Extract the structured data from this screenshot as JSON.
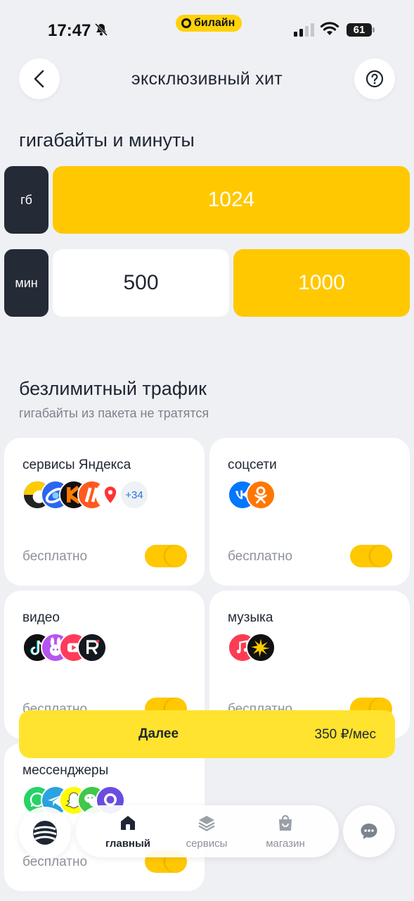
{
  "status": {
    "time": "17:47",
    "carrier": "билайн",
    "battery": "61"
  },
  "header": {
    "title": "эксклюзивный хит"
  },
  "package": {
    "heading": "гигабайты и минуты",
    "gb_label": "гб",
    "gb_options": [
      {
        "value": "1024",
        "selected": true
      }
    ],
    "min_label": "мин",
    "min_options": [
      {
        "value": "500",
        "selected": false
      },
      {
        "value": "1000",
        "selected": true
      }
    ]
  },
  "unlimited": {
    "heading": "безлимитный трафик",
    "subheading": "гигабайты из пакета не тратятся",
    "cards": [
      {
        "title": "сервисы Яндекса",
        "price": "бесплатно",
        "enabled": true,
        "more_count": "+34",
        "icons": [
          "yandex-go-icon",
          "yandex-browser-icon",
          "kinopoisk-icon",
          "yandex-maps-icon"
        ]
      },
      {
        "title": "соцсети",
        "price": "бесплатно",
        "enabled": true,
        "icons": [
          "vk-icon",
          "odnoklassniki-icon"
        ]
      },
      {
        "title": "видео",
        "price": "бесплатно",
        "enabled": true,
        "icons": [
          "tiktok-icon",
          "likee-icon",
          "vk-video-icon",
          "rutube-icon"
        ]
      },
      {
        "title": "музыка",
        "price": "бесплатно",
        "enabled": true,
        "icons": [
          "apple-music-icon",
          "yandex-music-icon"
        ]
      },
      {
        "title": "мессенджеры",
        "price": "бесплатно",
        "enabled": true,
        "icons": [
          "whatsapp-icon",
          "telegram-icon",
          "snapchat-icon",
          "wechat-icon",
          "viber-icon"
        ]
      }
    ]
  },
  "next": {
    "label": "Далее",
    "price": "350 ₽/мес"
  },
  "nav": {
    "items": [
      {
        "label": "главный",
        "active": true
      },
      {
        "label": "сервисы",
        "active": false
      },
      {
        "label": "магазин",
        "active": false
      }
    ]
  },
  "colors": {
    "accent": "#ffc800",
    "next_bar": "#ffe32e",
    "dark": "#242a36",
    "background": "#eef0f4"
  }
}
